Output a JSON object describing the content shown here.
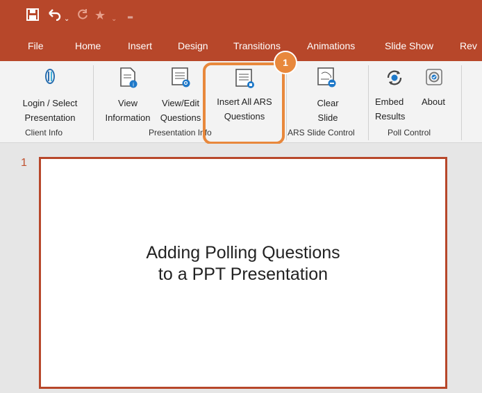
{
  "qat": {
    "save_icon": "save-icon",
    "undo_icon": "undo-icon",
    "redo_icon": "redo-icon",
    "star_icon": "star-icon",
    "customize_icon": "customize-qat-icon"
  },
  "tabs": [
    "File",
    "Home",
    "Insert",
    "Design",
    "Transitions",
    "Animations",
    "Slide Show",
    "Rev"
  ],
  "ribbon": {
    "client_info": {
      "group_label": "Client Info",
      "login_label": "Login / Select\nPresentation"
    },
    "presentation_info": {
      "group_label": "Presentation Info",
      "view_info_label": "View\nInformation",
      "view_edit_label": "View/Edit\nQuestions",
      "insert_all_label": "Insert All ARS\nQuestions"
    },
    "ars_slide_control": {
      "group_label": "ARS Slide Control",
      "clear_slide_label": "Clear\nSlide"
    },
    "poll_control": {
      "group_label": "Poll Control",
      "embed_label": "Embed\nResults",
      "about_label": "About"
    }
  },
  "callout": {
    "number": "1",
    "color": "#e8883c"
  },
  "slide": {
    "number": "1",
    "title": "Adding Polling Questions\nto a PPT Presentation"
  },
  "colors": {
    "accent": "#b7472a",
    "ribbon_bg": "#f3f3f3",
    "callout": "#e8883c"
  }
}
